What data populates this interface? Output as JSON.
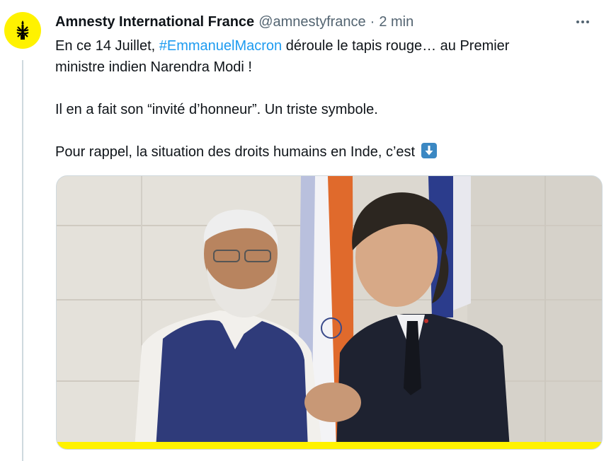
{
  "tweet": {
    "display_name": "Amnesty International France",
    "handle": "@amnestyfrance",
    "separator": "·",
    "time": "2 min",
    "text_part1": "En ce 14 Juillet, ",
    "hashtag": "#EmmanuelMacron",
    "text_part2": " déroule le tapis rouge… au Premier\nministre indien Narendra Modi !\n\nIl en a fait son “invité d’honneur”. Un triste symbole.\n\nPour rappel, la situation des droits humains en Inde, c’est",
    "emoji_icon": "down-arrow-emoji-icon",
    "avatar_icon": "amnesty-candle-logo-icon",
    "more_icon": "more-options-icon"
  },
  "media": {
    "icon": "photo-modi-macron",
    "accent_bar_color": "#fff200"
  },
  "colors": {
    "link": "#1d9bf0",
    "secondary_text": "#536471",
    "avatar_bg": "#fff200",
    "thread_line": "#cfd9de"
  }
}
